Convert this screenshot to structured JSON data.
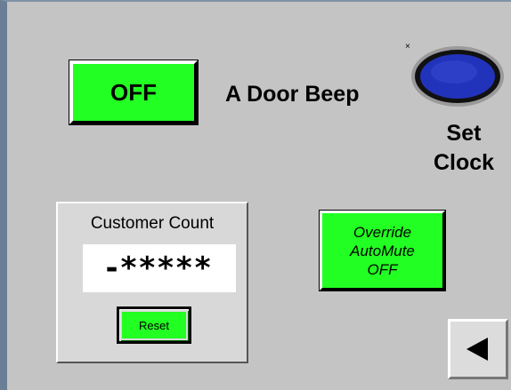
{
  "door_beep": {
    "toggle_label": "OFF",
    "label": "A Door Beep"
  },
  "clock": {
    "close_mark": "×",
    "label_line1": "Set",
    "label_line2": "Clock",
    "button_color": "#2233bb"
  },
  "customer_count": {
    "title": "Customer Count",
    "display": "-*****",
    "reset_label": "Reset"
  },
  "override": {
    "line1": "Override",
    "line2": "AutoMute",
    "line3": "OFF"
  },
  "navigation": {
    "back_icon": "left-triangle-icon"
  },
  "colors": {
    "button_green": "#22ff22",
    "background": "#c4c4c4"
  }
}
